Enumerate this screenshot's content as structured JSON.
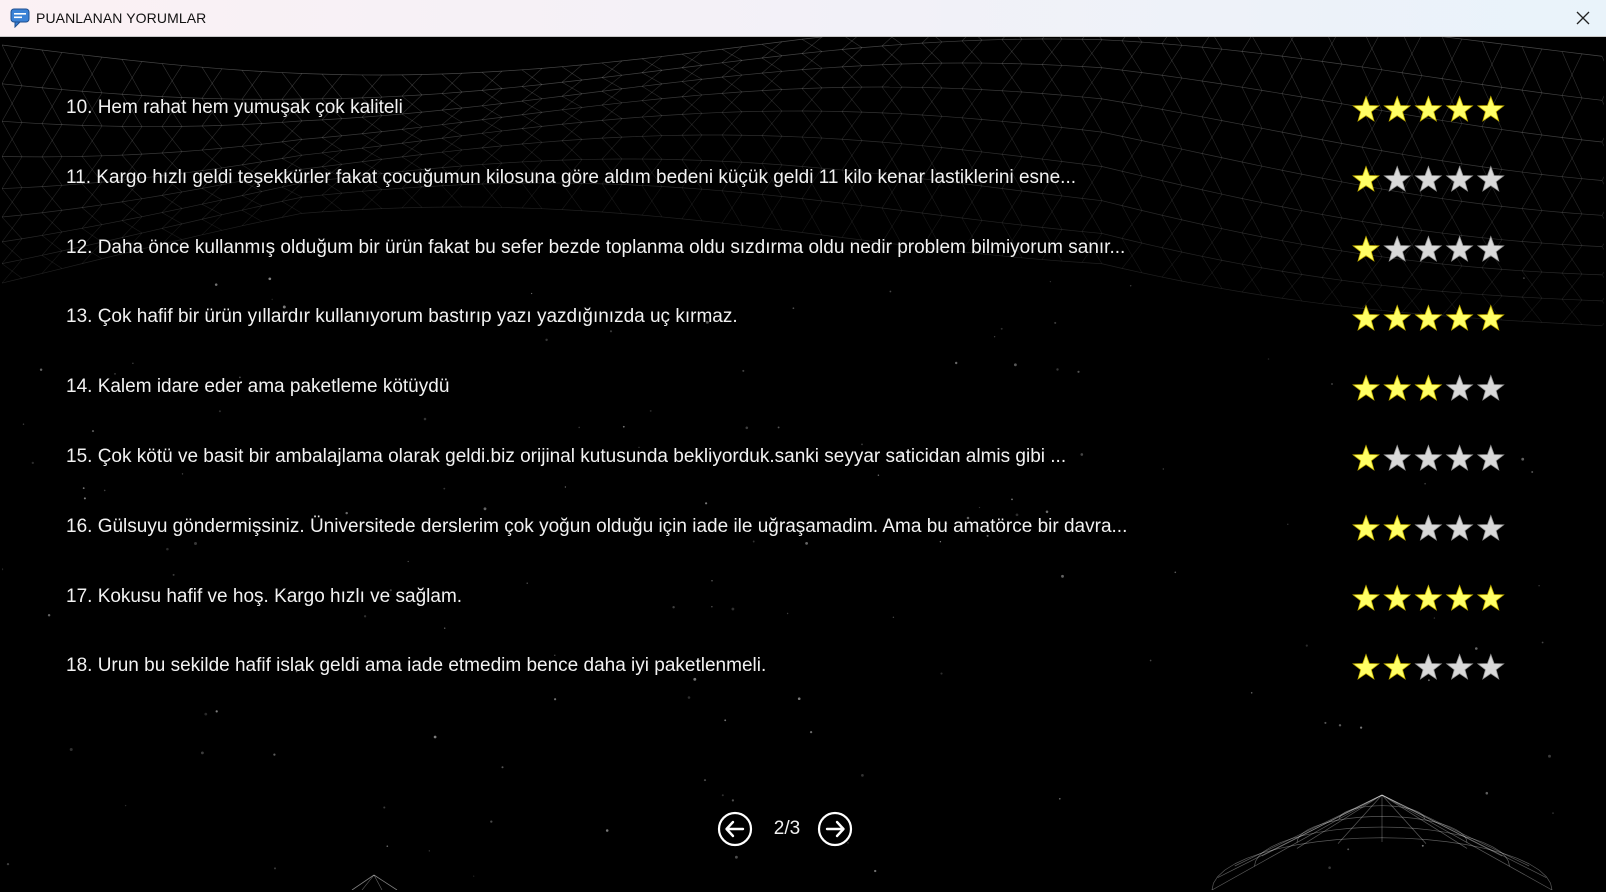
{
  "window": {
    "title": "PUANLANAN YORUMLAR",
    "app_icon": "chat-bubble-icon",
    "close_icon": "close-icon"
  },
  "colors": {
    "star_filled": "#ffff66",
    "star_empty": "#d9d9d9",
    "text": "#f2f2f2",
    "background": "#000000"
  },
  "reviews": [
    {
      "text": "10. Hem rahat hem yumuşak çok kaliteli",
      "rating": 5
    },
    {
      "text": "11. Kargo hızlı geldi teşekkürler fakat çocuğumun kilosuna göre aldım bedeni küçük geldi 11 kilo kenar lastiklerini esne...",
      "rating": 1
    },
    {
      "text": "12. Daha önce kullanmış olduğum bir ürün fakat bu sefer bezde toplanma oldu sızdırma oldu nedir problem bilmiyorum sanır...",
      "rating": 1
    },
    {
      "text": "13. Çok hafif bir ürün yıllardır kullanıyorum bastırıp yazı yazdığınızda uç kırmaz.",
      "rating": 5
    },
    {
      "text": "14. Kalem idare eder ama paketleme kötüydü",
      "rating": 3
    },
    {
      "text": "15. Çok kötü ve basit bir ambalajlama olarak geldi.biz orijinal kutusunda bekliyorduk.sanki seyyar saticidan almis gibi ...",
      "rating": 1
    },
    {
      "text": "16. Gülsuyu göndermişsiniz. Üniversitede derslerim çok yoğun olduğu için iade ile uğraşamadim. Ama bu amatörce bir davra...",
      "rating": 2
    },
    {
      "text": "17. Kokusu hafif ve hoş. Kargo hızlı ve sağlam.",
      "rating": 5
    },
    {
      "text": "18. Urun bu sekilde hafif islak geldi ama iade etmedim bence daha iyi paketlenmeli.",
      "rating": 2
    }
  ],
  "pagination": {
    "indicator": "2/3",
    "prev_icon": "arrow-left-circle-icon",
    "next_icon": "arrow-right-circle-icon"
  }
}
